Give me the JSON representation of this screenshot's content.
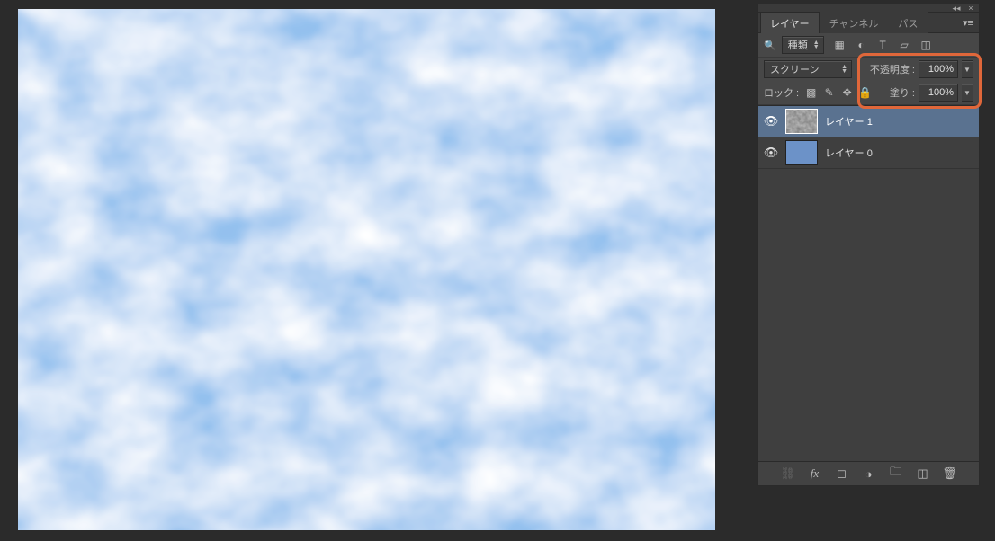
{
  "panel": {
    "tabs": [
      {
        "label": "レイヤー",
        "active": true
      },
      {
        "label": "チャンネル",
        "active": false
      },
      {
        "label": "パス",
        "active": false
      }
    ],
    "filter": {
      "kind_label": "種類",
      "icons": [
        "pixel",
        "adjustment",
        "type",
        "shape",
        "smartobject"
      ]
    },
    "blend": {
      "mode": "スクリーン",
      "opacity_label": "不透明度 :",
      "opacity_value": "100%",
      "fill_label": "塗り :",
      "fill_value": "100%"
    },
    "lock": {
      "label": "ロック :",
      "icons": [
        "transparency",
        "paint",
        "move",
        "all"
      ]
    },
    "layers": [
      {
        "name": "レイヤー 1",
        "visible": true,
        "selected": true,
        "thumb": "clouds"
      },
      {
        "name": "レイヤー 0",
        "visible": true,
        "selected": false,
        "thumb": "solid-blue"
      }
    ],
    "footer_icons": [
      "link",
      "fx",
      "mask",
      "adjustment",
      "group",
      "new",
      "trash"
    ]
  }
}
